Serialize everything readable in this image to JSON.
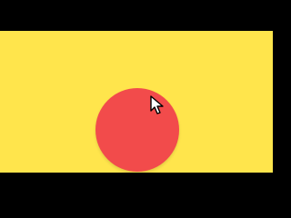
{
  "colors": {
    "background": "#000000",
    "stage": "#FFE54C",
    "circle": "#F24B4B",
    "cursor_fill": "#FFFFFF",
    "cursor_stroke": "#000000"
  },
  "stage": {
    "circle_button": {
      "icon": "circle"
    }
  },
  "cursor": {
    "icon": "mouse-pointer-icon"
  }
}
